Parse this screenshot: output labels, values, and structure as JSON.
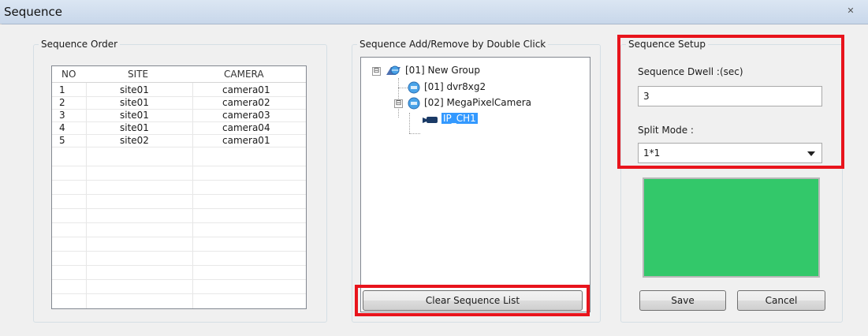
{
  "window": {
    "title": "Sequence"
  },
  "sequence_order": {
    "group_label": "Sequence Order",
    "columns": [
      "NO",
      "SITE",
      "CAMERA"
    ],
    "rows": [
      [
        "1",
        "site01",
        "camera01"
      ],
      [
        "2",
        "site01",
        "camera02"
      ],
      [
        "3",
        "site01",
        "camera03"
      ],
      [
        "4",
        "site01",
        "camera04"
      ],
      [
        "5",
        "site02",
        "camera01"
      ]
    ]
  },
  "add_remove": {
    "group_label": "Sequence Add/Remove by Double Click",
    "tree": [
      {
        "label": "[01] New Group",
        "icon": "group-icon",
        "expander": "⊟"
      },
      {
        "label": "[01] dvr8xg2",
        "icon": "dvr-icon"
      },
      {
        "label": "[02] MegaPixelCamera",
        "icon": "dvr-icon",
        "expander": "⊟"
      },
      {
        "label": "IP_CH1",
        "icon": "camera-icon",
        "selected": true
      }
    ],
    "clear_button": "Clear Sequence List"
  },
  "setup": {
    "group_label": "Sequence Setup",
    "dwell_label": "Sequence Dwell :(sec)",
    "dwell_value": "3",
    "split_label": "Split Mode :",
    "split_value": "1*1",
    "preview_color": "#33c86a",
    "save_button": "Save",
    "cancel_button": "Cancel"
  },
  "colors": {
    "highlight": "#e8141c",
    "selection": "#3399ff"
  }
}
